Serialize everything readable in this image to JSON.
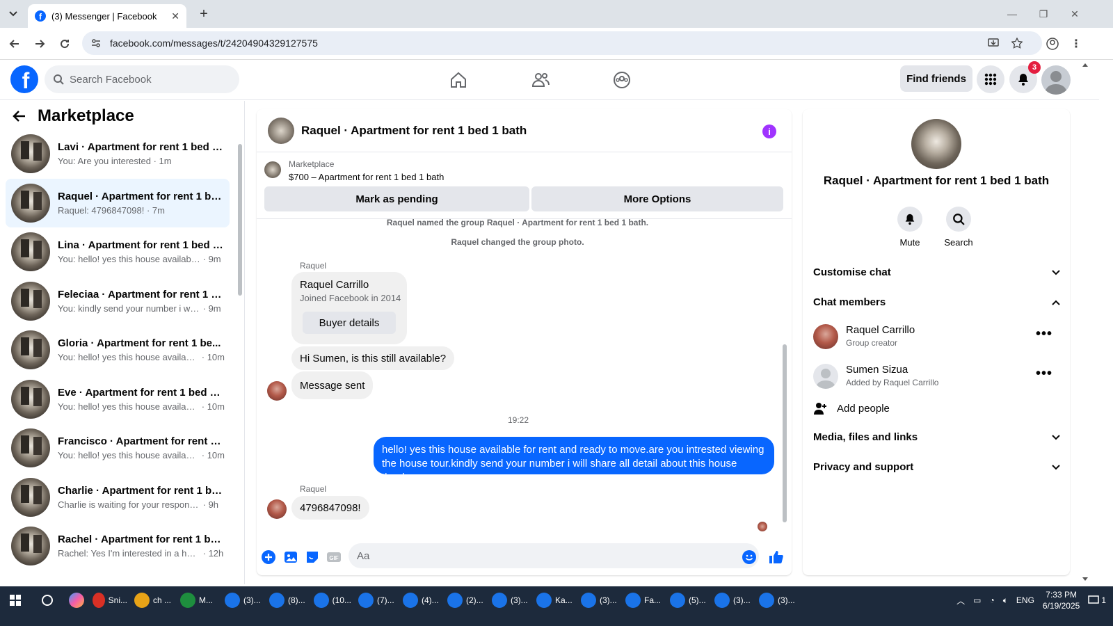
{
  "browser": {
    "tab_title": "(3) Messenger | Facebook",
    "url": "facebook.com/messages/t/24204904329127575"
  },
  "header": {
    "search_placeholder": "Search Facebook",
    "find_friends": "Find friends",
    "notification_count": "3"
  },
  "sidebar": {
    "title": "Marketplace",
    "conversations": [
      {
        "name": "Lavi · Apartment for rent 1 bed 1...",
        "snippet": "You: Are you interested",
        "time": "1m",
        "active": false
      },
      {
        "name": "Raquel · Apartment for rent 1 be...",
        "snippet": "Raquel: 4796847098!",
        "time": "7m",
        "active": true
      },
      {
        "name": "Lina · Apartment for rent 1 bed 1...",
        "snippet": "You: hello! yes this house available ...",
        "time": "9m",
        "active": false
      },
      {
        "name": "Feleciaa · Apartment for rent 1 b...",
        "snippet": "You: kindly send your number i will...",
        "time": "9m",
        "active": false
      },
      {
        "name": "Gloria · Apartment for rent 1 be...",
        "snippet": "You: hello! yes this house availabl...",
        "time": "10m",
        "active": false
      },
      {
        "name": "Eve · Apartment for rent 1 bed 1 ...",
        "snippet": "You: hello! yes this house availabl...",
        "time": "10m",
        "active": false
      },
      {
        "name": "Francisco · Apartment for rent 1 ...",
        "snippet": "You: hello! yes this house availabl...",
        "time": "10m",
        "active": false
      },
      {
        "name": "Charlie · Apartment for rent 1 be...",
        "snippet": "Charlie is waiting for your response.",
        "time": "9h",
        "active": false
      },
      {
        "name": "Rachel · Apartment for rent 1 be...",
        "snippet": "Rachel: Yes I'm interested in a hou...",
        "time": "12h",
        "active": false
      }
    ]
  },
  "chat": {
    "title": "Raquel · Apartment for rent 1 bed 1 bath",
    "marketplace_label": "Marketplace",
    "listing": "$700 – Apartment for rent 1 bed 1 bath",
    "mark_pending": "Mark as pending",
    "more_options": "More Options",
    "system_msg_1": "Raquel named the group Raquel · Apartment for rent 1 bed 1 bath.",
    "system_msg_2": "Raquel changed the group photo.",
    "sender_1": "Raquel",
    "card_name": "Raquel Carrillo",
    "card_sub": "Joined Facebook in 2014",
    "buyer_details": "Buyer details",
    "msg_1": "Hi Sumen, is this still available?",
    "msg_2": "Message sent",
    "time_sep": "19:22",
    "my_msg": "hello! yes this house available for rent and ready to move.are you intrested viewing the house tour.kindly send your number i will share all detail about this house thanks.",
    "sender_2": "Raquel",
    "msg_3": "4796847098!",
    "input_placeholder": "Aa"
  },
  "info": {
    "title": "Raquel · Apartment for rent 1 bed 1 bath",
    "mute": "Mute",
    "search": "Search",
    "customise_chat": "Customise chat",
    "chat_members": "Chat members",
    "members": [
      {
        "name": "Raquel Carrillo",
        "role": "Group creator"
      },
      {
        "name": "Sumen Sizua",
        "role": "Added by Raquel Carrillo"
      }
    ],
    "add_people": "Add people",
    "media": "Media, files and links",
    "privacy": "Privacy and support"
  },
  "taskbar": {
    "items": [
      "Sni...",
      "ch ...",
      "M...",
      "(3)...",
      "(8)...",
      "(10...",
      "(7)...",
      "(4)...",
      "(2)...",
      "(3)...",
      "Ka...",
      "(3)...",
      "Fa...",
      "(5)...",
      "(3)...",
      "(3)..."
    ],
    "lang": "ENG",
    "time": "7:33 PM",
    "date": "6/19/2025",
    "notif": "1"
  },
  "colors": {
    "fb_blue": "#0866ff",
    "accent_purple": "#a033ff",
    "active_row": "#ebf5ff"
  }
}
